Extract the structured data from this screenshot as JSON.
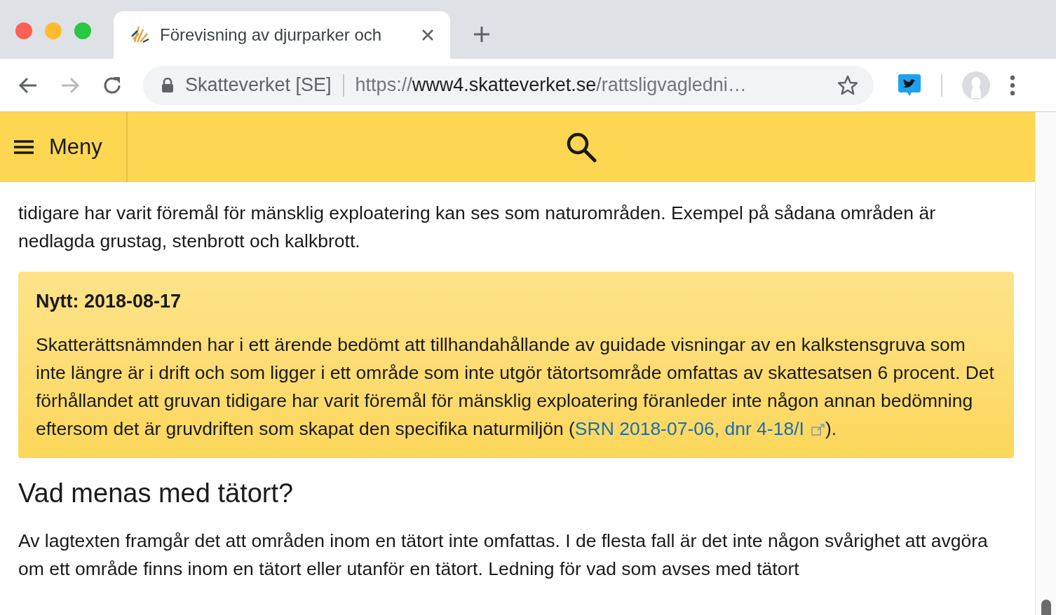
{
  "browser": {
    "tab": {
      "title": "Förevisning av djurparker och",
      "selected": true
    },
    "url_owner": "Skatteverket [SE]",
    "url": {
      "scheme": "https://",
      "host": "www4.skatteverket.se",
      "path": "/rattsligvagledni…"
    }
  },
  "header": {
    "menu_label": "Meny"
  },
  "paragraph_1": "tidigare har varit föremål för mänsklig exploatering kan ses som naturområden. Exempel på sådana områden är nedlagda grustag, stenbrott och kalkbrott.",
  "notice": {
    "title": "Nytt: 2018-08-17",
    "text_before": "Skatterättsnämnden har i ett ärende bedömt att tillhandahållande av guidade visningar av en kalkstensgruva som inte längre är i drift och som ligger i ett område som inte utgör tätortsområde omfattas av skattesatsen 6 procent. Det förhållandet att gruvan tidigare har varit föremål för mänsklig exploatering föranleder inte någon annan bedömning eftersom det är gruvdriften som skapat den specifika naturmiljön (",
    "link": "SRN 2018-07-06, dnr 4-18/I",
    "text_after": ")."
  },
  "heading": "Vad menas med tätort?",
  "paragraph_2": "Av lagtexten framgår det att områden inom en tätort inte omfattas. I de flesta fall är det inte någon svårighet att avgöra om ett område finns inom en tätort eller utanför en tätort. Ledning för vad som avses med tätort"
}
